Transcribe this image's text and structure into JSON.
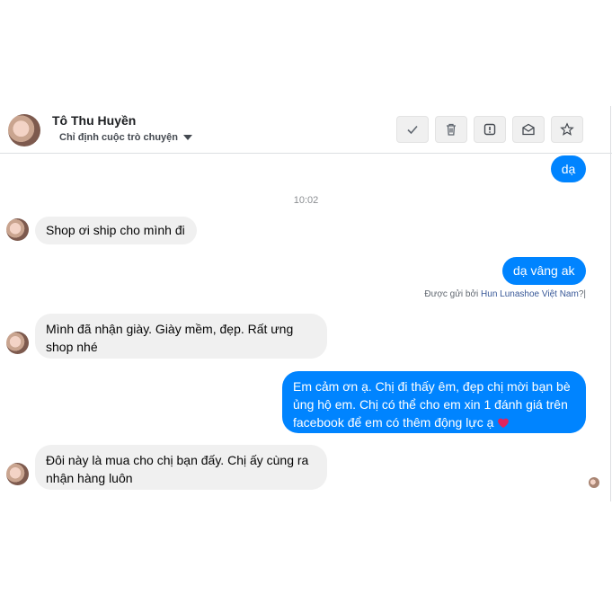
{
  "header": {
    "name": "Tô Thu Huyền",
    "assign_label": "Chỉ định cuộc trò chuyện",
    "actions": [
      "check-icon",
      "trash-icon",
      "alert-icon",
      "mail-icon",
      "star-icon"
    ]
  },
  "conversation": {
    "timestamp": "10:02",
    "messages": [
      {
        "side": "out",
        "text": "dạ"
      },
      {
        "side": "in",
        "text": "Shop ơi ship cho mình đi"
      },
      {
        "side": "out",
        "text": "dạ vâng ak"
      },
      {
        "side": "in",
        "text": "Mình đã nhận giày. Giày mềm, đẹp. Rất ưng shop nhé"
      },
      {
        "side": "out",
        "text": "Em cảm ơn ạ. Chị đi thấy êm, đẹp chị mời bạn bè ủng hộ em. Chị có thể cho em xin 1 đánh giá trên facebook để em có thêm động lực ạ"
      },
      {
        "side": "in",
        "text": "Đôi này là mua cho chị bạn đấy. Chị ấy cùng ra nhận hàng luôn"
      }
    ],
    "sent_by": {
      "prefix": "Được gửi bởi",
      "page": "Hun Lunashoe Việt Nam",
      "suffix": "?|"
    }
  },
  "colors": {
    "outgoing": "#0084ff",
    "incoming": "#f0f0f0",
    "heart": "#e0245e"
  }
}
